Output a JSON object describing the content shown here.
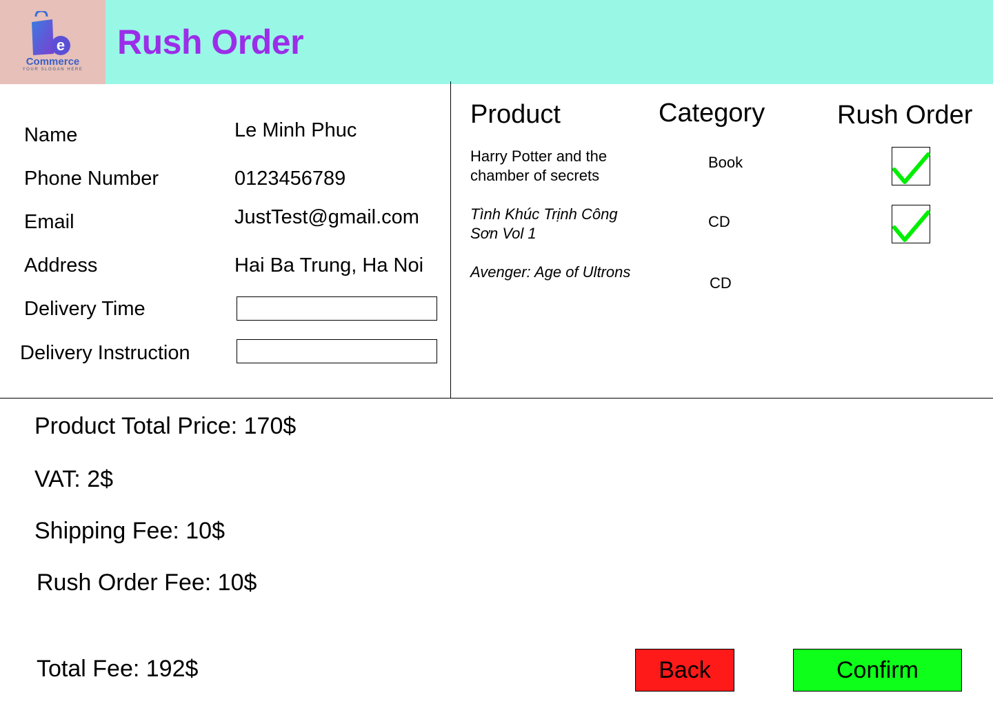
{
  "header": {
    "title": "Rush Order",
    "logo": {
      "icon": "shopping-bag-icon",
      "word": "Commerce",
      "letter": "e",
      "slogan": "YOUR SLOGAN HERE"
    },
    "background": "#99f7e6",
    "logo_background": "#e6c0b9",
    "title_color": "#9b2ee8"
  },
  "customer": {
    "name_label": "Name",
    "name_value": "Le Minh Phuc",
    "phone_label": "Phone Number",
    "phone_value": "0123456789",
    "email_label": "Email",
    "email_value": "JustTest@gmail.com",
    "address_label": "Address",
    "address_value": "Hai Ba Trung, Ha Noi",
    "delivery_time_label": "Delivery Time",
    "delivery_time_value": "",
    "delivery_instruction_label": "Delivery Instruction",
    "delivery_instruction_value": ""
  },
  "products": {
    "headers": {
      "product": "Product",
      "category": "Category",
      "rush": "Rush Order"
    },
    "rows": [
      {
        "name": "Harry Potter and the chamber of secrets",
        "category": "Book",
        "rush": true
      },
      {
        "name": "Tình Khúc Trịnh Công Sơn Vol 1",
        "category": "CD",
        "rush": true
      },
      {
        "name": "Avenger: Age of Ultrons",
        "category": "CD",
        "rush": false
      }
    ],
    "check_icon": "checkmark-icon",
    "check_color": "#00ee00"
  },
  "summary": {
    "product_total": "Product Total Price: 170$",
    "vat": "VAT: 2$",
    "shipping": "Shipping Fee: 10$",
    "rush_fee": "Rush Order Fee: 10$",
    "total": "Total Fee: 192$"
  },
  "buttons": {
    "back": "Back",
    "confirm": "Confirm",
    "back_color": "#ff1a1a",
    "confirm_color": "#0dff1a"
  }
}
